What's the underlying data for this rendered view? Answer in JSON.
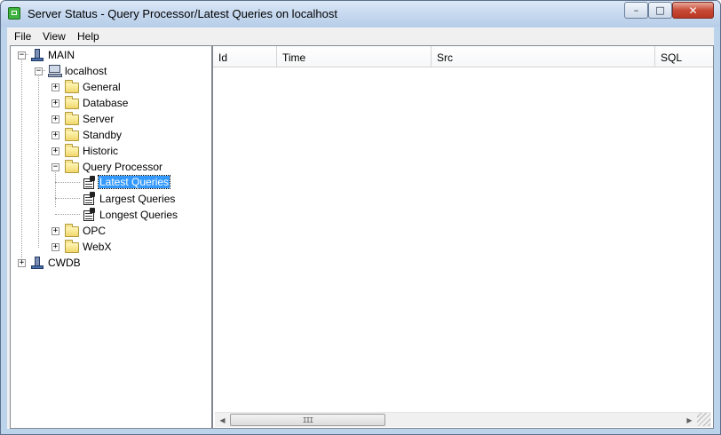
{
  "window": {
    "title": "Server Status - Query Processor/Latest Queries on localhost",
    "minimize_glyph": "–",
    "maximize_glyph": "□",
    "close_glyph": "✕"
  },
  "menu": {
    "file": "File",
    "view": "View",
    "help": "Help"
  },
  "tree": {
    "main": "MAIN",
    "localhost": "localhost",
    "general": "General",
    "database": "Database",
    "server": "Server",
    "standby": "Standby",
    "historic": "Historic",
    "query_processor": "Query Processor",
    "latest_queries": "Latest Queries",
    "largest_queries": "Largest Queries",
    "longest_queries": "Longest Queries",
    "opc": "OPC",
    "webx": "WebX",
    "cwdb": "CWDB",
    "expand_glyph": "+",
    "collapse_glyph": "−"
  },
  "list": {
    "columns": [
      "Id",
      "Time",
      "Src",
      "SQL"
    ]
  },
  "scrollbar": {
    "left_arrow": "◀",
    "right_arrow": "▶",
    "thumb_grip": "III"
  },
  "colors": {
    "selection": "#3399ff",
    "chrome": "#bcd3ec",
    "close_button": "#c74a36"
  }
}
